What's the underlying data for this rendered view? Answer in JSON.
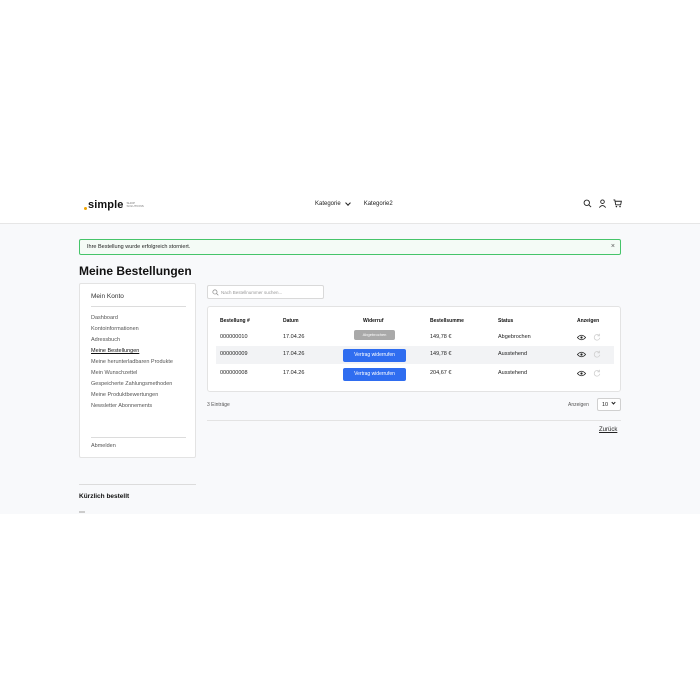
{
  "header": {
    "logo_word": "simple",
    "logo_sub": "Shop Solutions",
    "nav": [
      {
        "label": "Kategorie",
        "has_dropdown": true
      },
      {
        "label": "Kategorie2",
        "has_dropdown": false
      }
    ],
    "icons": [
      "search-icon",
      "user-icon",
      "cart-icon"
    ]
  },
  "alert": {
    "message": "Ihre Bestellung wurde erfolgreich storniert.",
    "close": "×",
    "color": "#46c46a"
  },
  "page": {
    "title": "Meine Bestellungen"
  },
  "sidebar": {
    "title": "Mein Konto",
    "items": [
      {
        "label": "Dashboard",
        "active": false
      },
      {
        "label": "Kontoinformationen",
        "active": false
      },
      {
        "label": "Adressbuch",
        "active": false
      },
      {
        "label": "Meine Bestellungen",
        "active": true
      },
      {
        "label": "Meine herunterladbaren Produkte",
        "active": false
      },
      {
        "label": "Mein Wunschzettel",
        "active": false
      },
      {
        "label": "Gespeicherte Zahlungsmethoden",
        "active": false
      },
      {
        "label": "Meine Produktbewertungen",
        "active": false
      },
      {
        "label": "Newsletter Abonnements",
        "active": false
      }
    ],
    "logout": "Abmelden"
  },
  "recent": {
    "title": "Kürzlich bestellt"
  },
  "search": {
    "placeholder": "Nach Bestellnummer suchen..."
  },
  "table": {
    "headers": {
      "order": "Bestellung #",
      "date": "Datum",
      "withdraw": "Widerruf",
      "total": "Bestellsumme",
      "status": "Status",
      "show": "Anzeigen"
    },
    "rows": [
      {
        "order": "000000010",
        "date": "17.04.26",
        "withdraw": "Abgebrochen",
        "withdraw_kind": "disabled",
        "total": "149,78 €",
        "status": "Abgebrochen"
      },
      {
        "order": "000000009",
        "date": "17.04.26",
        "withdraw": "Vertrag widerrufen",
        "withdraw_kind": "action",
        "total": "149,78 €",
        "status": "Ausstehend"
      },
      {
        "order": "000000008",
        "date": "17.04.26",
        "withdraw": "Vertrag widerrufen",
        "withdraw_kind": "action",
        "total": "204,67 €",
        "status": "Ausstehend"
      }
    ],
    "action_color": "#2f6df0"
  },
  "footer": {
    "entries": "3 Einträge",
    "show_label": "Anzeigen",
    "show_value": "10",
    "back": "Zurück"
  }
}
